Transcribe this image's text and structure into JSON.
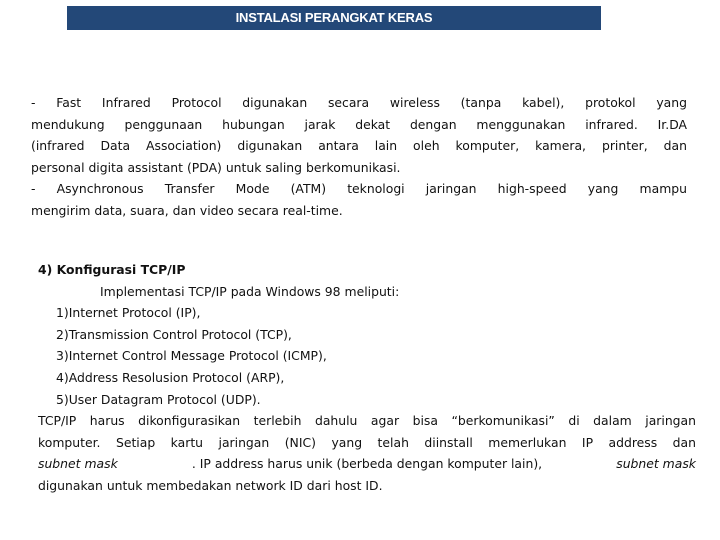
{
  "header": {
    "title": "INSTALASI PERANGKAT KERAS",
    "background_color": "#234878",
    "text_color": "#ffffff"
  },
  "paragraph1": {
    "lines": [
      "- Fast Infrared Protocol    digunakan secara wireless (tanpa kabel), protokol yang",
      "mendukung penggunaan hubungan jarak dekat dengan menggunakan infrared. Ir.DA",
      "(infrared Data Association) digunakan antara lain oleh komputer, kamera, printer, dan",
      "personal digita assistant (PDA) untuk saling berkomunikasi.",
      "-  Asynchronous Transfer Mode (ATM)  teknologi jaringan high-speed yang mampu",
      "mengirim data, suara, dan video secara real-time."
    ]
  },
  "section": {
    "heading": "4) Konfigurasi TCP/IP",
    "intro": "Implementasi TCP/IP pada Windows 98 meliputi:",
    "items": [
      {
        "num": "1)",
        "text": "Internet Protocol (IP),"
      },
      {
        "num": "2)",
        "text": "Transmission Control Protocol (TCP),"
      },
      {
        "num": "3)",
        "text": "Internet Control Message Protocol (ICMP),"
      },
      {
        "num": "4)",
        "text": "Address Resolusion Protocol (ARP),"
      },
      {
        "num": "5)",
        "text": "User Datagram Protocol (UDP)."
      }
    ],
    "paragraph": {
      "line1": "TCP/IP harus dikonfigurasikan terlebih dahulu agar bisa “berkomunikasi” di dalam jaringan",
      "line2": "komputer. Setiap kartu jaringan (NIC) yang telah diinstall memerlukan IP address dan",
      "line3_italic_a": "subnet mask",
      "line3_mid": ". IP address harus unik (berbeda dengan komputer lain),",
      "line3_italic_b": "subnet mask",
      "line4": "digunakan untuk membedakan network ID dari host ID."
    }
  }
}
